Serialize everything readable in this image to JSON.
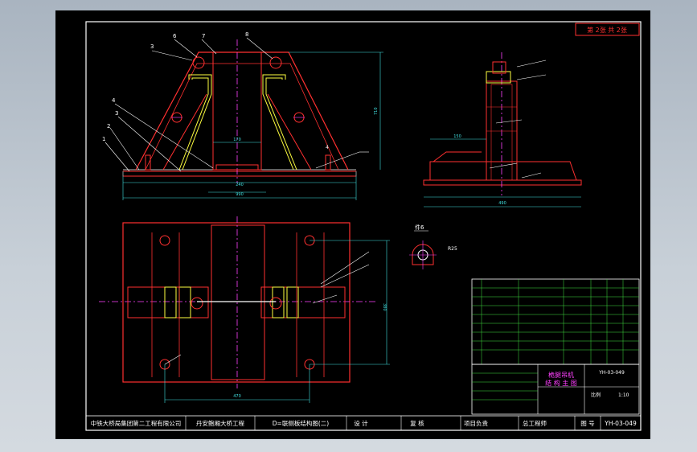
{
  "sheet_label": "第 2张 共 2张",
  "callouts": {
    "c1": "1",
    "c2": "2",
    "c3": "3",
    "c4": "4",
    "c6": "6",
    "c7": "7",
    "c8": "8"
  },
  "dims": {
    "front_base_width": "990",
    "front_inner": "240",
    "front_mid": "170",
    "front_height": "710",
    "side_base": "490",
    "side_top": "150",
    "plan_width": "470",
    "plan_height": "380",
    "detail_radius": "R25",
    "weld_4": "4"
  },
  "detail": {
    "title": "件6"
  },
  "title_block": {
    "company": "中铁大桥局集团第二工程有限公司",
    "project": "丹安鲍厢大桥工程",
    "drawing_name": "D=联侧板结构图(二)",
    "design": "设 计",
    "check": "复 核",
    "pm": "项目负责",
    "engineer": "总工程师",
    "fig_no_label": "图 号",
    "fig_no": "YH-03-049",
    "part_title_1": "桅腿吊机",
    "part_title_2": "结 构 主 图",
    "scale_label": "比例",
    "scale": "1:10",
    "code": "YH-03-049"
  }
}
